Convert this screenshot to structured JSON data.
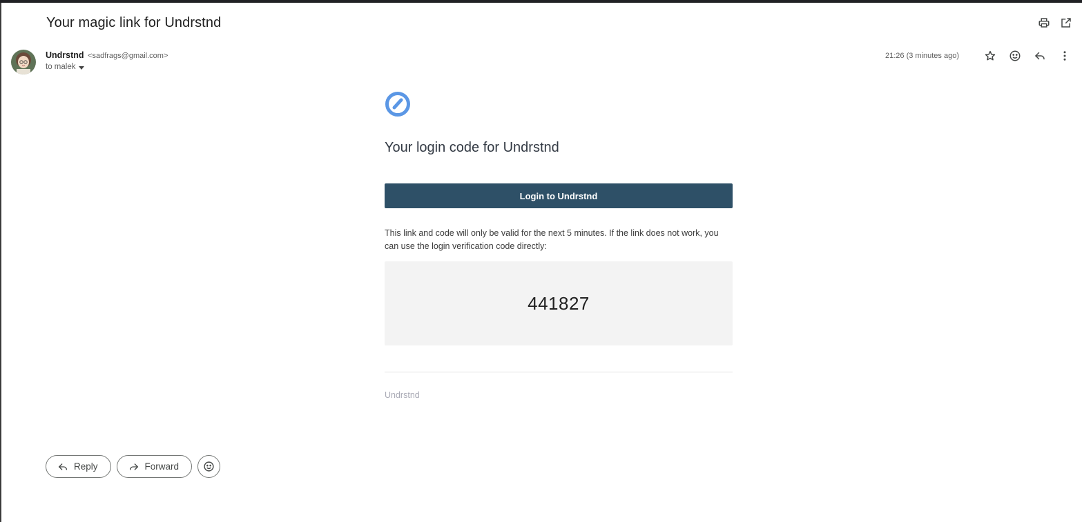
{
  "email": {
    "subject": "Your magic link for Undrstnd",
    "sender_name": "Undrstnd",
    "sender_email": "<sadfrags@gmail.com>",
    "to_line": "to malek",
    "timestamp": "21:26 (3 minutes ago)"
  },
  "body": {
    "logo_icon": "undrstnd-logo-icon",
    "title": "Your login code for Undrstnd",
    "login_button": "Login to Undrstnd",
    "explanation": "This link and code will only be valid for the next 5 minutes. If the link does not work, you can use the login verification code directly:",
    "code": "441827",
    "footer_brand": "Undrstnd"
  },
  "actions": {
    "reply_label": "Reply",
    "forward_label": "Forward"
  },
  "icons": {
    "print": "print-icon",
    "open_new_window": "open-in-new-window-icon",
    "star": "star-icon",
    "emoji": "emoji-icon",
    "reply": "reply-icon",
    "more": "more-vert-icon"
  },
  "colors": {
    "button_bg": "#2e5067",
    "logo_blue": "#5b97e5",
    "code_box_bg": "#f3f3f3"
  }
}
